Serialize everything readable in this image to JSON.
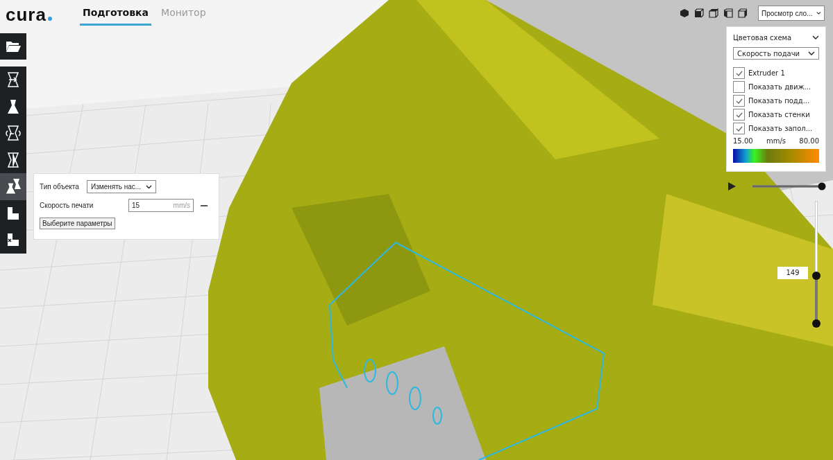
{
  "header": {
    "logo": "cura",
    "tabs": [
      {
        "label": "Подготовка",
        "selected": true
      },
      {
        "label": "Монитор",
        "selected": false
      }
    ]
  },
  "toolbar": {
    "tools": [
      {
        "kind": "move",
        "selected": false
      },
      {
        "kind": "scale",
        "selected": false
      },
      {
        "kind": "rotate",
        "selected": false
      },
      {
        "kind": "mirror",
        "selected": false
      },
      {
        "kind": "per_model",
        "selected": true
      },
      {
        "kind": "support_blocker",
        "selected": false
      },
      {
        "kind": "support_eraser",
        "selected": false
      }
    ]
  },
  "view_controls": {
    "view_mode": "Просмотр сло..."
  },
  "layer_panel": {
    "color_scheme_label": "Цветовая схема",
    "color_scheme": "Скорость подачи",
    "options": [
      {
        "label": "Extruder 1",
        "checked": true
      },
      {
        "label": "Показать движ...",
        "checked": false
      },
      {
        "label": "Показать подд...",
        "checked": true
      },
      {
        "label": "Показать стенки",
        "checked": true
      },
      {
        "label": "Показать запол...",
        "checked": true
      }
    ],
    "legend": {
      "min": "15.00",
      "unit": "mm/s",
      "max": "80.00"
    }
  },
  "playback": {
    "level": 1
  },
  "layer_slider": {
    "value": "149",
    "level": 0.39
  },
  "per_model_settings": {
    "mesh_type_label": "Тип объекта",
    "mesh_type": "Изменять нас...",
    "settings": [
      {
        "label": "Скорость печати",
        "value": "15",
        "unit": "mm/s"
      }
    ],
    "button": "Выберите параметры"
  }
}
